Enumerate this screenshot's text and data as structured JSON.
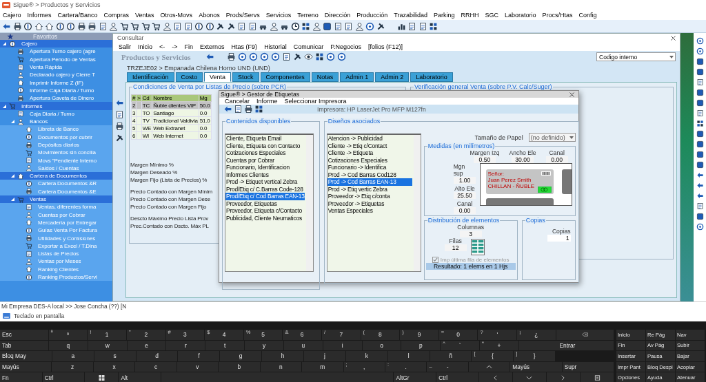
{
  "app": {
    "title": "Sigue® > Productos y Servicios"
  },
  "menu": [
    "Cajero",
    "Informes",
    "Cartera/Banco",
    "Compras",
    "Ventas",
    "Otros-Movs",
    "Abonos",
    "Prods/Servs",
    "Servicios",
    "Terreno",
    "Dirección",
    "Producción",
    "Trazabilidad",
    "Parking",
    "RRHH",
    "SGC",
    "Laboratorio",
    "Procs/Htas",
    "Config"
  ],
  "sidebar": {
    "header": "Favoritos",
    "tree": [
      {
        "label": "Cajero",
        "highlighted": true,
        "expanded": true,
        "children": [
          {
            "label": "Apertura Turno cajero (agre",
            "highlighted": false
          },
          {
            "label": "Apertura Periodo de Ventas",
            "highlighted": false
          },
          {
            "label": "Venta Rápida",
            "highlighted": false
          },
          {
            "label": "Declarado cajero y Cierre T",
            "highlighted": false
          },
          {
            "label": "Imprimir Informe Z (IF)",
            "highlighted": false
          },
          {
            "label": "Informe Caja Diaria / Turno",
            "highlighted": false
          },
          {
            "label": "Apertura Gaveta de Dinero",
            "highlighted": false
          }
        ]
      },
      {
        "label": "Informes",
        "highlighted": true,
        "expanded": true,
        "children": [
          {
            "label": "Caja Diaria / Turno",
            "highlighted": false
          },
          {
            "label": "Bancos",
            "highlighted": false,
            "expanded": true,
            "children": [
              {
                "label": "Libreta de Banco",
                "highlighted": false
              },
              {
                "label": "Documentos por cubrir",
                "highlighted": false
              },
              {
                "label": "Depósitos diarios",
                "highlighted": false
              },
              {
                "label": "Movimientos sin concilia",
                "highlighted": false
              },
              {
                "label": "Movs \"Pendiente Interno",
                "highlighted": false
              },
              {
                "label": "Saldos / Cuentas",
                "highlighted": false
              }
            ]
          },
          {
            "label": "Cartera de Documentos",
            "highlighted": true,
            "expanded": true,
            "children": [
              {
                "label": "Cartera Documentos &R",
                "highlighted": false
              },
              {
                "label": "Cartera Documentos &E",
                "highlighted": false
              }
            ]
          },
          {
            "label": "Ventas",
            "highlighted": true,
            "expanded": true,
            "children": [
              {
                "label": "Ventas, diferentes forma",
                "highlighted": false
              },
              {
                "label": "Cuentas por Cobrar",
                "highlighted": false
              },
              {
                "label": "Mercadería por Entregar",
                "highlighted": false
              },
              {
                "label": "Guías Venta Por Factura",
                "highlighted": false
              },
              {
                "label": "Utilidades y Comisiones",
                "highlighted": false
              },
              {
                "label": "Exportar a Excel / T.Dina",
                "highlighted": false
              },
              {
                "label": "Listas de Precios",
                "highlighted": false
              },
              {
                "label": "Ventas por Meses",
                "highlighted": false
              },
              {
                "label": "Ranking Clientes",
                "highlighted": false
              },
              {
                "label": "Ranking Productos/Servi",
                "highlighted": false
              }
            ]
          }
        ]
      }
    ]
  },
  "window": {
    "title": "Consultar",
    "menu": [
      "Salir",
      "Inicio",
      "<-",
      "->",
      "Fin",
      "Externos",
      "Htas (F9)",
      "Historial",
      "Comunicar",
      "P.Negocios",
      "[folios (F12)]"
    ],
    "heading": "Productos y Servicios",
    "lookup": {
      "value": "Codigo interno"
    },
    "breadcrumb": "TRZEJE02 > Empanada Chilena Horno UND (UND)",
    "tabs": [
      {
        "label": "Identificación",
        "selected": false
      },
      {
        "label": "Costo",
        "selected": false
      },
      {
        "label": "Venta",
        "selected": true
      },
      {
        "label": "Stock",
        "selected": false
      },
      {
        "label": "Componentes",
        "selected": false
      },
      {
        "label": "Notas",
        "selected": false
      },
      {
        "label": "Admin 1",
        "selected": false
      },
      {
        "label": "Admin 2",
        "selected": false
      },
      {
        "label": "Laboratorio",
        "selected": false
      }
    ],
    "conditions_title": "Condiciones de Venta por Listas de Precio (sobre PCR)",
    "verification_title": "Verificación general Venta (sobre P.V. Calc/Suger)",
    "table": {
      "columns": [
        "#",
        ">",
        "Cd",
        "Nombre",
        "Mg"
      ],
      "rows": [
        {
          "cells": [
            "2",
            "",
            "TC",
            "Ñuble clientes VIP",
            "50.0"
          ],
          "selected": true
        },
        {
          "cells": [
            "3",
            "",
            "TO",
            "Santiago",
            "0.0"
          ],
          "selected": false
        },
        {
          "cells": [
            "4",
            "",
            "TV",
            "Tradicional Valdivia",
            "51.0"
          ],
          "selected": false
        },
        {
          "cells": [
            "5",
            "",
            "WE",
            "Web Extranet",
            "0.0"
          ],
          "selected": false
        },
        {
          "cells": [
            "6",
            "",
            "WI",
            "Web Internet",
            "0.0"
          ],
          "selected": false
        }
      ]
    },
    "field_groups": [
      [
        "Margen Mínimo %",
        "Margen Deseado %",
        "Margen Fijo (Lista de Precios) %"
      ],
      [
        "Precio Contado con Margen Mínim",
        "Precio Contado con Margen Dese",
        "Precio Contado con Margen Fijo"
      ],
      [
        "Descto Máximo Precio Lista Prov",
        "Prec.Contado con Dscto. Máx PL"
      ]
    ]
  },
  "dialog": {
    "title": "Sigue® > Gestor de Etiquetas",
    "menu": [
      "Cancelar",
      "Informe",
      "Seleccionar Impresora"
    ],
    "printer": "Impresora: HP LaserJet Pro MFP M127fn",
    "available": {
      "title": "Contenidos disponibles",
      "items": [
        {
          "label": "Cliente, Etiqueta Email",
          "selected": false
        },
        {
          "label": "Cliente, Etiqueta con Contacto",
          "selected": false
        },
        {
          "label": "Cotizaciones Especiales",
          "selected": false
        },
        {
          "label": "Cuentas por Cobrar",
          "selected": false
        },
        {
          "label": "Funcionario, Identificacion",
          "selected": false
        },
        {
          "label": "Informes Clientes",
          "selected": false
        },
        {
          "label": "Prod -> Etiquet vertical Zebra",
          "selected": false
        },
        {
          "label": "Prod/Etiq c/ C.Barras Code-128",
          "selected": false
        },
        {
          "label": "Prod/Etiq c/ Cod Barras EAN-13",
          "selected": true
        },
        {
          "label": "Proveedor, Etiquetas",
          "selected": false
        },
        {
          "label": "Proveedor, Etiqueta c/Contacto",
          "selected": false
        },
        {
          "label": "Publicidad, Cliente Neumaticos",
          "selected": false
        }
      ]
    },
    "designs": {
      "title": "Diseños asociados",
      "items": [
        {
          "label": "Atencion -> Publicidad",
          "selected": false
        },
        {
          "label": "Cliente -> Etiq c/Contact",
          "selected": false
        },
        {
          "label": "Cliente -> Etiqueta",
          "selected": false
        },
        {
          "label": "Cotizaciones Especiales",
          "selected": false
        },
        {
          "label": "Funcionario -> Identifica",
          "selected": false
        },
        {
          "label": "Prod -> Cod Barras Cod128",
          "selected": false
        },
        {
          "label": "Prod -> Cod Barras EAN-13",
          "selected": true
        },
        {
          "label": "Prod -> Etiq vertic Zebra",
          "selected": false
        },
        {
          "label": "Proveedor -> Etiq c/conta",
          "selected": false
        },
        {
          "label": "Proveedor -> Etiquetas",
          "selected": false
        },
        {
          "label": "Ventas Especiales",
          "selected": false
        }
      ]
    },
    "paper": {
      "label": "Tamaño de Papel",
      "value": "(no definido)"
    },
    "measures": {
      "title": "Medidas (en milímetros)",
      "top": [
        {
          "label": "Margen Izq",
          "value": "0.50"
        },
        {
          "label": "Ancho Ele",
          "value": "30.00"
        },
        {
          "label": "Canal",
          "value": "0.00"
        }
      ],
      "left": [
        {
          "label": "Mgn sup",
          "value": "1.00"
        },
        {
          "label": "Alto Ele",
          "value": "25.50"
        },
        {
          "label": "Canal",
          "value": "0.00"
        }
      ],
      "preview_lines": [
        "Señor:",
        "Juan Perez Smith",
        "CHILLAN - ÑUBLE"
      ]
    },
    "distribution": {
      "title": "Distribución de elementos",
      "columns": {
        "label": "Columnas",
        "value": "3"
      },
      "rows": {
        "label": "Filas",
        "value": "12"
      },
      "last_row": {
        "label": "Imp última fila de elementos",
        "checked": true,
        "disabled": true
      },
      "result": "Resultado: 1 elems en 1 Hjs"
    },
    "copies": {
      "title": "Copias",
      "label": "Copias",
      "value": "1"
    }
  },
  "status_bar": "Mi Empresa DES-A local >> Jose Concha (??) [N",
  "keyboard": {
    "title": "Teclado en pantalla",
    "rows": [
      {
        "keys": [
          {
            "kind": "text",
            "label": "Esc"
          },
          {
            "kind": "char",
            "shift": "ª",
            "label": "º"
          },
          {
            "kind": "char",
            "shift": "!",
            "label": "1"
          },
          {
            "kind": "char",
            "shift": "\"",
            "label": "2"
          },
          {
            "kind": "char",
            "shift": "#",
            "label": "3"
          },
          {
            "kind": "char",
            "shift": "$",
            "label": "4"
          },
          {
            "kind": "char",
            "shift": "%",
            "label": "5"
          },
          {
            "kind": "char",
            "shift": "&",
            "label": "6"
          },
          {
            "kind": "char",
            "shift": "/",
            "label": "7"
          },
          {
            "kind": "char",
            "shift": "(",
            "label": "8"
          },
          {
            "kind": "char",
            "shift": ")",
            "label": "9"
          },
          {
            "kind": "char",
            "shift": "=",
            "label": "0"
          },
          {
            "kind": "char",
            "shift": "?",
            "label": "'"
          },
          {
            "kind": "char",
            "shift": "¡",
            "label": "¿"
          },
          {
            "kind": "backspace"
          }
        ]
      },
      {
        "keys": [
          {
            "kind": "text",
            "label": "Tab"
          },
          {
            "kind": "char",
            "label": "q"
          },
          {
            "kind": "char",
            "label": "w"
          },
          {
            "kind": "char",
            "label": "e"
          },
          {
            "kind": "char",
            "label": "r"
          },
          {
            "kind": "char",
            "label": "t"
          },
          {
            "kind": "char",
            "label": "y"
          },
          {
            "kind": "char",
            "label": "u"
          },
          {
            "kind": "char",
            "label": "i"
          },
          {
            "kind": "char",
            "label": "o"
          },
          {
            "kind": "char",
            "label": "p"
          },
          {
            "kind": "char",
            "shift": "^",
            "label": "`"
          },
          {
            "kind": "char",
            "shift": "*",
            "label": "+"
          },
          {
            "kind": "big",
            "label": "Entrar"
          }
        ]
      },
      {
        "keys": [
          {
            "kind": "text",
            "label": "Bloq May"
          },
          {
            "kind": "char",
            "label": "a"
          },
          {
            "kind": "char",
            "label": "s"
          },
          {
            "kind": "char",
            "label": "d"
          },
          {
            "kind": "char",
            "label": "f"
          },
          {
            "kind": "char",
            "label": "g"
          },
          {
            "kind": "char",
            "label": "h"
          },
          {
            "kind": "char",
            "label": "j"
          },
          {
            "kind": "char",
            "label": "k"
          },
          {
            "kind": "char",
            "label": "l"
          },
          {
            "kind": "char",
            "label": "ñ"
          },
          {
            "kind": "char",
            "shift": "[",
            "label": "{"
          },
          {
            "kind": "char",
            "shift": "]",
            "label": "}"
          },
          {
            "kind": "blank"
          }
        ]
      },
      {
        "keys": [
          {
            "kind": "text",
            "label": "Mayús"
          },
          {
            "kind": "char",
            "label": "z"
          },
          {
            "kind": "char",
            "label": "x"
          },
          {
            "kind": "char",
            "label": "c"
          },
          {
            "kind": "char",
            "label": "v"
          },
          {
            "kind": "char",
            "label": "b"
          },
          {
            "kind": "char",
            "label": "n"
          },
          {
            "kind": "char",
            "label": "m"
          },
          {
            "kind": "char",
            "shift": ";",
            "label": ","
          },
          {
            "kind": "char",
            "shift": ":",
            "label": "."
          },
          {
            "kind": "char",
            "shift": "_",
            "label": "-"
          },
          {
            "kind": "up"
          },
          {
            "kind": "text",
            "label": "Mayús"
          },
          {
            "kind": "text",
            "label": "Supr"
          }
        ]
      },
      {
        "keys": [
          {
            "kind": "text",
            "label": "Fn"
          },
          {
            "kind": "text",
            "label": "Ctrl"
          },
          {
            "kind": "windows"
          },
          {
            "kind": "text",
            "label": "Alt"
          },
          {
            "kind": "space"
          },
          {
            "kind": "text",
            "label": "AltGr"
          },
          {
            "kind": "text",
            "label": "Ctrl"
          },
          {
            "kind": "left"
          },
          {
            "kind": "down"
          },
          {
            "kind": "right"
          },
          {
            "kind": "menu"
          }
        ]
      }
    ],
    "nav_keys": [
      "Inicio",
      "Re Pág",
      "Nav",
      "Fin",
      "Av Pág",
      "Subir",
      "Insertar",
      "Pausa",
      "Bajar",
      "Impr Pant",
      "Bloq Despl",
      "Acoplar",
      "Opciones",
      "Ayuda",
      "Atenuar"
    ]
  }
}
